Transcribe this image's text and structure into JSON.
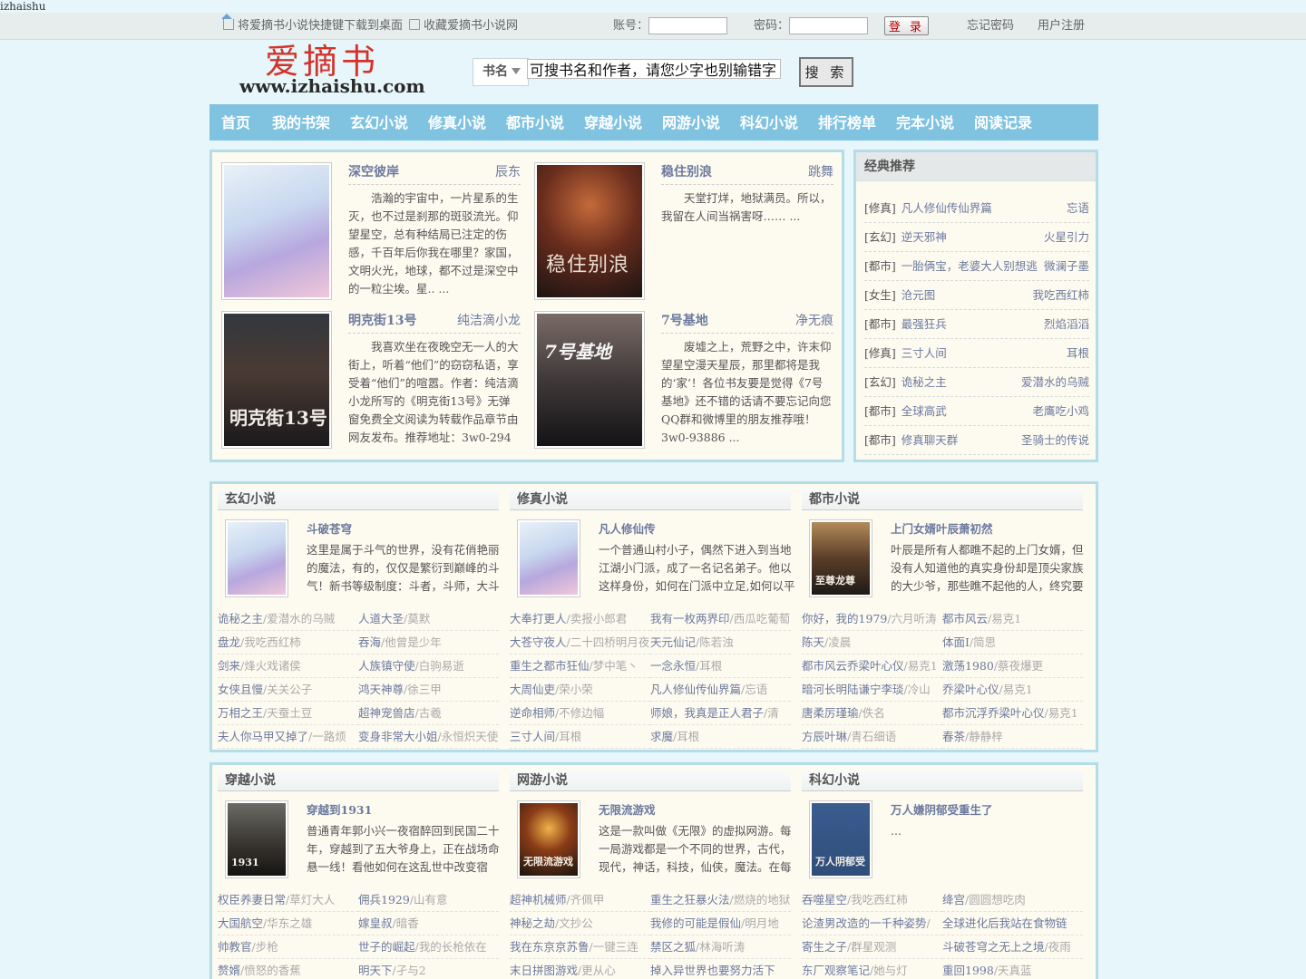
{
  "site_tag": "izhaishu",
  "topbar": {
    "shortcut_link": "将爱摘书小说快捷键下载到桌面",
    "favorite_link": "收藏爱摘书小说网",
    "account_label": "账号：",
    "password_label": "密码：",
    "login_button": "登 录",
    "forgot_link": "忘记密码",
    "register_link": "用户注册"
  },
  "header": {
    "logo_cn": "爱摘书",
    "logo_url": "www.izhaishu.com",
    "search_type": "书名",
    "search_placeholder": "可搜书名和作者，请您少字也别输错字",
    "search_button": "搜 索"
  },
  "nav": [
    "首页",
    "我的书架",
    "玄幻小说",
    "修真小说",
    "都市小说",
    "穿越小说",
    "网游小说",
    "科幻小说",
    "排行榜单",
    "完本小说",
    "阅读记录"
  ],
  "featured": [
    {
      "title": "深空彼岸",
      "author": "辰东",
      "desc": "浩瀚的宇宙中，一片星系的生灭，也不过是刹那的斑驳流光。仰望星空，总有种结局已注定的伤感，千百年后你我在哪里？家国，文明火光，地球，都不过是深空中的一粒尘埃。星.. ...",
      "cover": "pink"
    },
    {
      "title": "稳住别浪",
      "author": "跳舞",
      "desc": "天堂打烊，地狱满员。所以，我留在人间当祸害呀…… ...",
      "cover": "orange",
      "cover_text": "稳住别浪"
    },
    {
      "title": "明克街13号",
      "author": "纯洁滴小龙",
      "desc": "我喜欢坐在夜晚空无一人的大街上，听着“他们”的窃窃私语，享受着“他们”的喧嚣。作者：纯洁滴小龙所写的《明克街13号》无弹窗免费全文阅读为转载作品章节由网友发布。推荐地址：3w0-294 ...",
      "cover": "dark",
      "cover_text": "明克街13号"
    },
    {
      "title": "7号基地",
      "author": "净无痕",
      "desc": "废墟之上，荒野之中，许末仰望星空漫天星辰，那里都将是我的‘家’！各位书友要是觉得《7号基地》还不错的话请不要忘记向您QQ群和微博里的朋友推荐哦！3w0-93886 ...",
      "cover": "night",
      "cover_text": "7号基地"
    }
  ],
  "sidebar": {
    "title": "经典推荐",
    "items": [
      {
        "cat": "[修真]",
        "book": "凡人修仙传仙界篇",
        "author": "忘语"
      },
      {
        "cat": "[玄幻]",
        "book": "逆天邪神",
        "author": "火星引力"
      },
      {
        "cat": "[都市]",
        "book": "一胎俩宝，老婆大人别想逃",
        "author": "微澜子墨"
      },
      {
        "cat": "[女生]",
        "book": "沧元图",
        "author": "我吃西红柿"
      },
      {
        "cat": "[都市]",
        "book": "最强狂兵",
        "author": "烈焰滔滔"
      },
      {
        "cat": "[修真]",
        "book": "三寸人间",
        "author": "耳根"
      },
      {
        "cat": "[玄幻]",
        "book": "诡秘之主",
        "author": "爱潜水的乌贼"
      },
      {
        "cat": "[都市]",
        "book": "全球高武",
        "author": "老鹰吃小鸡"
      },
      {
        "cat": "[都市]",
        "book": "修真聊天群",
        "author": "圣骑士的传说"
      }
    ]
  },
  "categories": [
    {
      "name": "玄幻小说",
      "top": {
        "title": "斗破苍穹",
        "desc": "这里是属于斗气的世界，没有花俏艳丽的魔法，有的，仅仅是繁衍到巅峰的斗气！新书等级制度：斗者，斗师，大斗师，斗",
        "cover": "pink"
      },
      "list": [
        {
          "book": "诡秘之主",
          "author": "/爱潜水的乌贼"
        },
        {
          "book": "人道大圣",
          "author": "/莫默"
        },
        {
          "book": "盘龙",
          "author": "/我吃西红柿"
        },
        {
          "book": "吞海",
          "author": "/他曾是少年"
        },
        {
          "book": "剑来",
          "author": "/烽火戏诸侯"
        },
        {
          "book": "人族镇守使",
          "author": "/白驹易逝"
        },
        {
          "book": "女侠且慢",
          "author": "/关关公子"
        },
        {
          "book": "鸿天神尊",
          "author": "/徐三甲"
        },
        {
          "book": "万相之王",
          "author": "/天蚕土豆"
        },
        {
          "book": "超神宠兽店",
          "author": "/古羲"
        },
        {
          "book": "夫人你马甲又掉了",
          "author": "/一路烦"
        },
        {
          "book": "变身非常大小姐",
          "author": "/永恒炽天使"
        }
      ]
    },
    {
      "name": "修真小说",
      "top": {
        "title": "凡人修仙传",
        "desc": "一个普通山村小子，偶然下进入到当地江湖小门派，成了一名记名弟子。他以这样身份，如何在门派中立足,如何以平庸的资",
        "cover": "pink"
      },
      "list": [
        {
          "book": "大奉打更人",
          "author": "/卖报小郎君"
        },
        {
          "book": "我有一枚两界印",
          "author": "/西瓜吃葡萄"
        },
        {
          "book": "大苍守夜人",
          "author": "/二十四桥明月夜"
        },
        {
          "book": "天元仙记",
          "author": "/陈若浊"
        },
        {
          "book": "重生之都市狂仙",
          "author": "/梦中笔丶"
        },
        {
          "book": "一念永恒",
          "author": "/耳根"
        },
        {
          "book": "大周仙吏",
          "author": "/荣小荣"
        },
        {
          "book": "凡人修仙传仙界篇",
          "author": "/忘语"
        },
        {
          "book": "逆命相师",
          "author": "/不修边幅"
        },
        {
          "book": "师娘，我真是正人君子",
          "author": "/清"
        },
        {
          "book": "三寸人间",
          "author": "/耳根"
        },
        {
          "book": "求魔",
          "author": "/耳根"
        }
      ]
    },
    {
      "name": "都市小说",
      "top": {
        "title": "上门女婿叶辰萧初然",
        "desc": "叶辰是所有人都瞧不起的上门女婿，但没有人知道他的真实身份却是顶尖家族的大少爷，那些瞧不起他的人，终究要跪在他",
        "cover": "warrior",
        "cover_text": "至尊龙尊"
      },
      "list": [
        {
          "book": "你好，我的1979",
          "author": "/六月听涛"
        },
        {
          "book": "都市风云",
          "author": "/易克1"
        },
        {
          "book": "陈天",
          "author": "/凌晨"
        },
        {
          "book": "体面I",
          "author": "/简思"
        },
        {
          "book": "都市风云乔梁叶心仪",
          "author": "/易克1"
        },
        {
          "book": "激荡1980",
          "author": "/蔡夜爆更"
        },
        {
          "book": "暗河长明陆谦宁李琰",
          "author": "/冷山"
        },
        {
          "book": "乔梁叶心仪",
          "author": "/易克1"
        },
        {
          "book": "唐柔厉瑾瑜",
          "author": "/佚名"
        },
        {
          "book": "都市沉浮乔梁叶心仪",
          "author": "/易克1"
        },
        {
          "book": "方辰叶琳",
          "author": "/青石细语"
        },
        {
          "book": "春茶",
          "author": "/静静梓"
        }
      ]
    },
    {
      "name": "穿越小说",
      "top": {
        "title": "穿越到1931",
        "desc": "普通青年郭小兴一夜宿醉回到民国二十年，穿越到了五大爷身上，正在战场命悬一线！看他如何在这乱世中改变宿命……",
        "cover": "war",
        "cover_text": "1931"
      },
      "list": [
        {
          "book": "权臣养妻日常",
          "author": "/草灯大人"
        },
        {
          "book": "佣兵1929",
          "author": "/山有意"
        },
        {
          "book": "大国航空",
          "author": "/华东之雄"
        },
        {
          "book": "嫁皇叔",
          "author": "/暗香"
        },
        {
          "book": "帅教官",
          "author": "/步枪"
        },
        {
          "book": "世子的崛起",
          "author": "/我的长枪依在"
        },
        {
          "book": "赘婿",
          "author": "/愤怒的香蕉"
        },
        {
          "book": "明天下",
          "author": "/孑与2"
        }
      ]
    },
    {
      "name": "网游小说",
      "top": {
        "title": "无限流游戏",
        "desc": "这是一款叫做《无限》的虚拟网游。每一局游戏都是一个不同的世界，古代，现代，神话，科技，仙侠，魔法。在每局游",
        "cover": "fire",
        "cover_text": "无限流游戏"
      },
      "list": [
        {
          "book": "超神机械师",
          "author": "/齐佩甲"
        },
        {
          "book": "重生之狂暴火法",
          "author": "/燃烧的地狱"
        },
        {
          "book": "神秘之劫",
          "author": "/文抄公"
        },
        {
          "book": "我修的可能是假仙",
          "author": "/明月地"
        },
        {
          "book": "我在东京京苏鲁",
          "author": "/一键三连"
        },
        {
          "book": "禁区之狐",
          "author": "/林海听涛"
        },
        {
          "book": "末日拼图游戏",
          "author": "/更从心"
        },
        {
          "book": "掉入异世界也要努力活下",
          "author": ""
        }
      ]
    },
    {
      "name": "科幻小说",
      "top": {
        "title": "万人嫌阴郁受重生了",
        "desc": "...",
        "cover": "blue",
        "cover_text": "万人阴郁受"
      },
      "list": [
        {
          "book": "吞噬星空",
          "author": "/我吃西红柿"
        },
        {
          "book": "绛宫",
          "author": "/圆圆想吃肉"
        },
        {
          "book": "论渣男改造的一千种姿势",
          "author": "/"
        },
        {
          "book": "全球进化后我站在食物链",
          "author": ""
        },
        {
          "book": "寄生之子",
          "author": "/群星观测"
        },
        {
          "book": "斗破苍穹之无上之境",
          "author": "/夜雨"
        },
        {
          "book": "东厂观察笔记",
          "author": "/她与灯"
        },
        {
          "book": "重回1998",
          "author": "/天真蓝"
        }
      ]
    }
  ]
}
